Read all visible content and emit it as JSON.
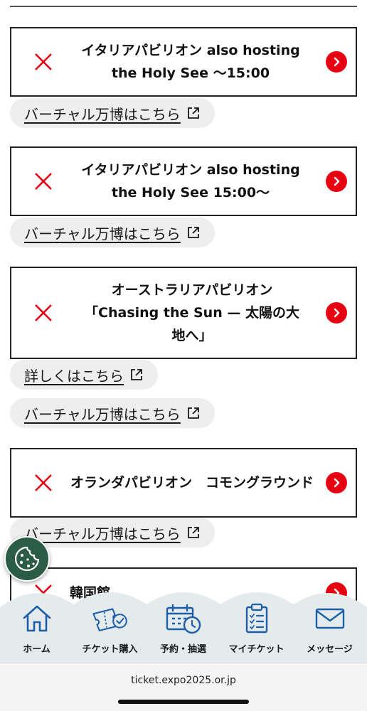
{
  "pavilions": [
    {
      "title": "イタリアパビリオン also hosting the Holy See 〜15:00",
      "links": [
        "バーチャル万博はこちら"
      ]
    },
    {
      "title": "イタリアパビリオン also hosting the Holy See 15:00〜",
      "links": [
        "バーチャル万博はこちら"
      ]
    },
    {
      "title": "オーストラリアパビリオン「Chasing the Sun — 太陽の大地へ」",
      "links": [
        "詳しくはこちら",
        "バーチャル万博はこちら"
      ]
    },
    {
      "title": "オランダパビリオン　コモングラウンド",
      "links": [
        "バーチャル万博はこちら"
      ]
    },
    {
      "title": "韓国館",
      "links": []
    }
  ],
  "nav": {
    "items": [
      {
        "label": "ホーム",
        "icon": "home-icon"
      },
      {
        "label": "チケット購入",
        "icon": "ticket-icon"
      },
      {
        "label": "予約・抽選",
        "icon": "calendar-icon"
      },
      {
        "label": "マイチケット",
        "icon": "clipboard-icon"
      },
      {
        "label": "メッセージ",
        "icon": "mail-icon"
      }
    ]
  },
  "browser": {
    "url": "ticket.expo2025.or.jp"
  },
  "colors": {
    "accent_red": "#e60012",
    "nav_blue": "#1f5fa8",
    "cookie_green": "#2b5c45"
  }
}
